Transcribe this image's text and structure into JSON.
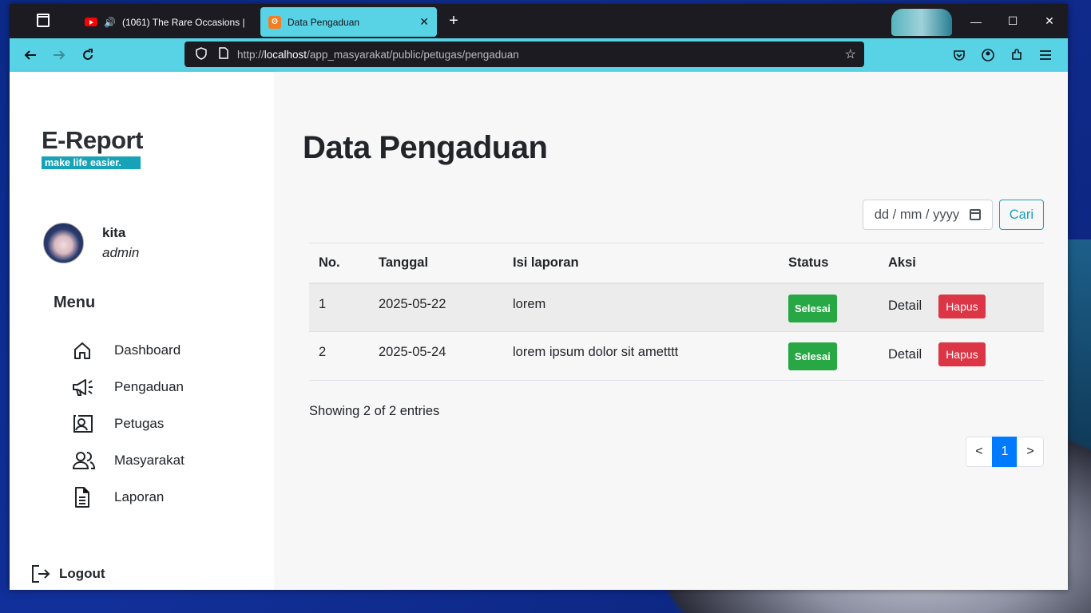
{
  "browser": {
    "tabs": [
      {
        "title": "(1061) The Rare Occasions | ",
        "active": false,
        "favicon": "youtube-icon",
        "audio": true
      },
      {
        "title": "Data Pengaduan",
        "active": true,
        "favicon": "xampp-icon"
      }
    ],
    "new_tab": "+",
    "url": {
      "prefix": "http://",
      "host": "localhost",
      "path": "/app_masyarakat/public/petugas/pengaduan"
    },
    "window_controls": [
      "minimize",
      "maximize",
      "close"
    ],
    "colors": {
      "toolbar": "#58d3e6",
      "tabbar": "#1c1b22"
    }
  },
  "sidebar": {
    "brand": "E-Report",
    "tagline": "make life easier.",
    "user": {
      "name": "kita",
      "role": "admin"
    },
    "menu_title": "Menu",
    "items": [
      {
        "label": "Dashboard",
        "icon": "home-icon"
      },
      {
        "label": "Pengaduan",
        "icon": "megaphone-icon"
      },
      {
        "label": "Petugas",
        "icon": "id-card-icon"
      },
      {
        "label": "Masyarakat",
        "icon": "users-icon"
      },
      {
        "label": "Laporan",
        "icon": "document-icon"
      }
    ],
    "logout": "Logout"
  },
  "main": {
    "title": "Data Pengaduan",
    "filter": {
      "date_placeholder": "dd / mm / yyyy",
      "search_label": "Cari"
    },
    "table": {
      "headers": [
        "No.",
        "Tanggal",
        "Isi laporan",
        "Status",
        "Aksi"
      ],
      "rows": [
        {
          "no": "1",
          "tanggal": "2025-05-22",
          "isi": "lorem",
          "status": "Selesai",
          "detail": "Detail",
          "hapus": "Hapus"
        },
        {
          "no": "2",
          "tanggal": "2025-05-24",
          "isi": "lorem ipsum dolor sit ametttt",
          "status": "Selesai",
          "detail": "Detail",
          "hapus": "Hapus"
        }
      ]
    },
    "showing": "Showing 2 of 2 entries",
    "pagination": {
      "prev": "<",
      "current": "1",
      "next": ">"
    },
    "colors": {
      "success": "#28a745",
      "danger": "#dc3545",
      "info": "#17a2b8",
      "primary": "#007bff"
    }
  }
}
